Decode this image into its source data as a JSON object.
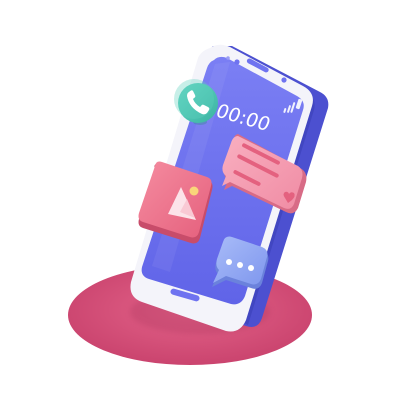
{
  "scene": {
    "phone": {
      "clock": "00:00",
      "colors": {
        "screen": "#6F73F0",
        "frame": "#F4F4FA",
        "frame_side": "#4C50D0"
      }
    },
    "icons": {
      "call": "phone-call-icon",
      "gallery": "image-gallery-icon",
      "message": "chat-message-icon",
      "typing": "typing-bubble-icon",
      "heart": "heart-icon"
    },
    "colors": {
      "pedestal": "#D9527C",
      "call_bubble": "#4FC7B5",
      "gallery_card": "#F0798F",
      "message_bubble": "#F7A0B2",
      "typing_bubble": "#8FA8F4"
    }
  }
}
